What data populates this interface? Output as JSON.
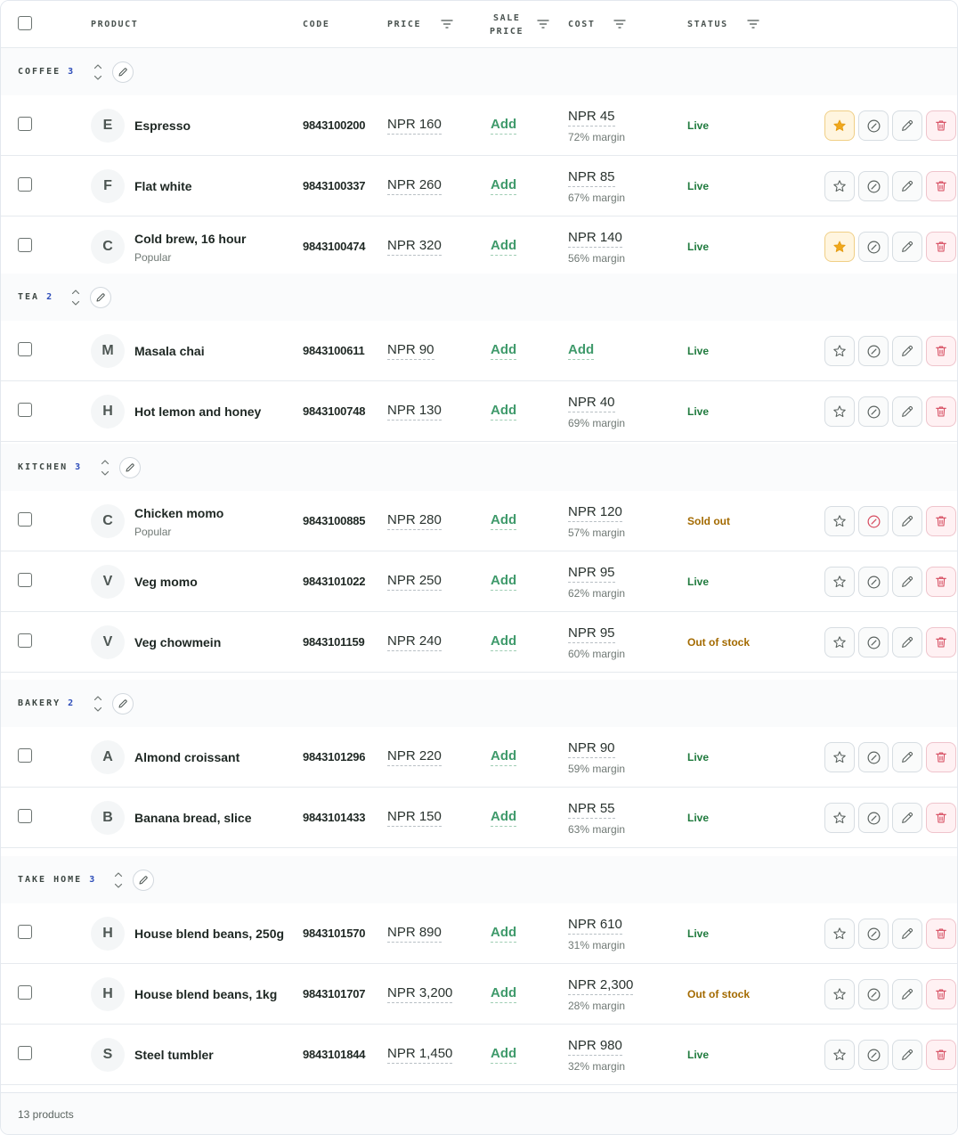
{
  "header": {
    "product": "PRODUCT",
    "code": "CODE",
    "price": "PRICE",
    "sale_price_line1": "SALE",
    "sale_price_line2": "PRICE",
    "cost": "COST",
    "status": "STATUS"
  },
  "groups": [
    {
      "name": "COFFEE",
      "count": "3",
      "rows": [
        {
          "initial": "E",
          "name": "Espresso",
          "sub": "",
          "code": "9843100200",
          "price": "NPR 160",
          "sale": "Add",
          "cost": "NPR 45",
          "margin": "72% margin",
          "status": "Live",
          "status_kind": "live",
          "starred": true,
          "blocked": false
        },
        {
          "initial": "F",
          "name": "Flat white",
          "sub": "",
          "code": "9843100337",
          "price": "NPR 260",
          "sale": "Add",
          "cost": "NPR 85",
          "margin": "67% margin",
          "status": "Live",
          "status_kind": "live",
          "starred": false,
          "blocked": false
        },
        {
          "initial": "C",
          "name": "Cold brew, 16 hour",
          "sub": "Popular",
          "code": "9843100474",
          "price": "NPR 320",
          "sale": "Add",
          "cost": "NPR 140",
          "margin": "56% margin",
          "status": "Live",
          "status_kind": "live",
          "starred": true,
          "blocked": false
        }
      ]
    },
    {
      "name": "TEA",
      "count": "2",
      "rows": [
        {
          "initial": "M",
          "name": "Masala chai",
          "sub": "",
          "code": "9843100611",
          "price": "NPR 90",
          "sale": "Add",
          "cost": "Add",
          "margin": "",
          "status": "Live",
          "status_kind": "live",
          "starred": false,
          "blocked": false
        },
        {
          "initial": "H",
          "name": "Hot lemon and honey",
          "sub": "",
          "code": "9843100748",
          "price": "NPR 130",
          "sale": "Add",
          "cost": "NPR 40",
          "margin": "69% margin",
          "status": "Live",
          "status_kind": "live",
          "starred": false,
          "blocked": false
        }
      ]
    },
    {
      "name": "KITCHEN",
      "count": "3",
      "rows": [
        {
          "initial": "C",
          "name": "Chicken momo",
          "sub": "Popular",
          "code": "9843100885",
          "price": "NPR 280",
          "sale": "Add",
          "cost": "NPR 120",
          "margin": "57% margin",
          "status": "Sold out",
          "status_kind": "warn",
          "starred": false,
          "blocked": true
        },
        {
          "initial": "V",
          "name": "Veg momo",
          "sub": "",
          "code": "9843101022",
          "price": "NPR 250",
          "sale": "Add",
          "cost": "NPR 95",
          "margin": "62% margin",
          "status": "Live",
          "status_kind": "live",
          "starred": false,
          "blocked": false
        },
        {
          "initial": "V",
          "name": "Veg chowmein",
          "sub": "",
          "code": "9843101159",
          "price": "NPR 240",
          "sale": "Add",
          "cost": "NPR 95",
          "margin": "60% margin",
          "status": "Out of stock",
          "status_kind": "warn",
          "starred": false,
          "blocked": false
        }
      ]
    },
    {
      "name": "BAKERY",
      "count": "2",
      "rows": [
        {
          "initial": "A",
          "name": "Almond croissant",
          "sub": "",
          "code": "9843101296",
          "price": "NPR 220",
          "sale": "Add",
          "cost": "NPR 90",
          "margin": "59% margin",
          "status": "Live",
          "status_kind": "live",
          "starred": false,
          "blocked": false
        },
        {
          "initial": "B",
          "name": "Banana bread, slice",
          "sub": "",
          "code": "9843101433",
          "price": "NPR 150",
          "sale": "Add",
          "cost": "NPR 55",
          "margin": "63% margin",
          "status": "Live",
          "status_kind": "live",
          "starred": false,
          "blocked": false
        }
      ]
    },
    {
      "name": "TAKE HOME",
      "count": "3",
      "rows": [
        {
          "initial": "H",
          "name": "House blend beans, 250g",
          "sub": "",
          "code": "9843101570",
          "price": "NPR 890",
          "sale": "Add",
          "cost": "NPR 610",
          "margin": "31% margin",
          "status": "Live",
          "status_kind": "live",
          "starred": false,
          "blocked": false
        },
        {
          "initial": "H",
          "name": "House blend beans, 1kg",
          "sub": "",
          "code": "9843101707",
          "price": "NPR 3,200",
          "sale": "Add",
          "cost": "NPR 2,300",
          "margin": "28% margin",
          "status": "Out of stock",
          "status_kind": "warn",
          "starred": false,
          "blocked": false
        },
        {
          "initial": "S",
          "name": "Steel tumbler",
          "sub": "",
          "code": "9843101844",
          "price": "NPR 1,450",
          "sale": "Add",
          "cost": "NPR 980",
          "margin": "32% margin",
          "status": "Live",
          "status_kind": "live",
          "starred": false,
          "blocked": false
        }
      ]
    }
  ],
  "footer": {
    "count_text": "13 products"
  },
  "icons": {
    "filter": "filter-icon",
    "sort": "sort-arrows-icon",
    "edit": "pencil-icon",
    "star": "star-icon",
    "block": "block-icon",
    "delete": "trash-icon"
  },
  "colors": {
    "add_link": "#3f9a6b",
    "live": "#1f7a3d",
    "warn": "#a36a00",
    "star_active": "#f0a81c",
    "delete": "#d64a5e",
    "group_count": "#2b4bb8"
  }
}
